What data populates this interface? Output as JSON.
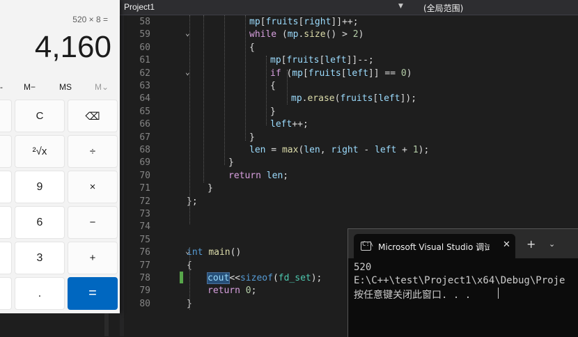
{
  "editor": {
    "project": "Project1",
    "scope": "(全局范围)",
    "lines": [
      {
        "n": "58",
        "fold": "",
        "tokens": [
          [
            "mp",
            "var"
          ],
          [
            "[",
            ""
          ],
          [
            "fruits",
            "var"
          ],
          [
            "[",
            ""
          ],
          [
            "right",
            "var"
          ],
          [
            "]]++;",
            ""
          ]
        ]
      },
      {
        "n": "59",
        "fold": "⌄",
        "tokens": [
          [
            "while",
            "kw2"
          ],
          [
            " (",
            ""
          ],
          [
            "mp",
            "var"
          ],
          [
            ".",
            ""
          ],
          [
            "size",
            "fn"
          ],
          [
            "() > ",
            ""
          ],
          [
            "2",
            "num"
          ],
          [
            ")",
            ""
          ]
        ]
      },
      {
        "n": "60",
        "fold": "",
        "tokens": [
          [
            "{",
            ""
          ]
        ]
      },
      {
        "n": "61",
        "fold": "",
        "tokens": [
          [
            "mp",
            "var"
          ],
          [
            "[",
            ""
          ],
          [
            "fruits",
            "var"
          ],
          [
            "[",
            ""
          ],
          [
            "left",
            "var"
          ],
          [
            "]]--;",
            ""
          ]
        ]
      },
      {
        "n": "62",
        "fold": "⌄",
        "tokens": [
          [
            "if",
            "kw2"
          ],
          [
            " (",
            ""
          ],
          [
            "mp",
            "var"
          ],
          [
            "[",
            ""
          ],
          [
            "fruits",
            "var"
          ],
          [
            "[",
            ""
          ],
          [
            "left",
            "var"
          ],
          [
            "]] == ",
            ""
          ],
          [
            "0",
            "num"
          ],
          [
            ")",
            ""
          ]
        ]
      },
      {
        "n": "63",
        "fold": "",
        "tokens": [
          [
            "{",
            ""
          ]
        ]
      },
      {
        "n": "64",
        "fold": "",
        "tokens": [
          [
            "mp",
            "var"
          ],
          [
            ".",
            ""
          ],
          [
            "erase",
            "fn"
          ],
          [
            "(",
            ""
          ],
          [
            "fruits",
            "var"
          ],
          [
            "[",
            ""
          ],
          [
            "left",
            "var"
          ],
          [
            "]);",
            ""
          ]
        ]
      },
      {
        "n": "65",
        "fold": "",
        "tokens": [
          [
            "}",
            ""
          ]
        ]
      },
      {
        "n": "66",
        "fold": "",
        "tokens": [
          [
            "left",
            "var"
          ],
          [
            "++;",
            ""
          ]
        ]
      },
      {
        "n": "67",
        "fold": "",
        "tokens": [
          [
            "}",
            ""
          ]
        ]
      },
      {
        "n": "68",
        "fold": "",
        "tokens": [
          [
            "len",
            "var"
          ],
          [
            " = ",
            ""
          ],
          [
            "max",
            "fn"
          ],
          [
            "(",
            ""
          ],
          [
            "len",
            "var"
          ],
          [
            ", ",
            ""
          ],
          [
            "right",
            "var"
          ],
          [
            " - ",
            ""
          ],
          [
            "left",
            "var"
          ],
          [
            " + ",
            ""
          ],
          [
            "1",
            "num"
          ],
          [
            ");",
            ""
          ]
        ]
      },
      {
        "n": "69",
        "fold": "",
        "tokens": [
          [
            "}",
            ""
          ]
        ]
      },
      {
        "n": "70",
        "fold": "",
        "tokens": [
          [
            "return",
            "kw2"
          ],
          [
            " ",
            ""
          ],
          [
            "len",
            "var"
          ],
          [
            ";",
            ""
          ]
        ]
      },
      {
        "n": "71",
        "fold": "",
        "tokens": [
          [
            "}",
            ""
          ]
        ]
      },
      {
        "n": "72",
        "fold": "",
        "tokens": [
          [
            "};",
            ""
          ]
        ]
      },
      {
        "n": "73",
        "fold": "",
        "tokens": []
      },
      {
        "n": "74",
        "fold": "",
        "tokens": []
      },
      {
        "n": "75",
        "fold": "",
        "tokens": []
      },
      {
        "n": "76",
        "fold": "⌄",
        "tokens": [
          [
            "int",
            "kw"
          ],
          [
            " ",
            ""
          ],
          [
            "main",
            "fn"
          ],
          [
            "()",
            ""
          ]
        ]
      },
      {
        "n": "77",
        "fold": "",
        "tokens": [
          [
            "{",
            ""
          ]
        ]
      },
      {
        "n": "78",
        "fold": "",
        "tokens": [
          [
            "cout",
            "var hl"
          ],
          [
            "<<",
            ""
          ],
          [
            "sizeof",
            "kw"
          ],
          [
            "(",
            ""
          ],
          [
            "fd_set",
            "ty"
          ],
          [
            ");",
            ""
          ]
        ]
      },
      {
        "n": "79",
        "fold": "",
        "tokens": [
          [
            "return",
            "kw2"
          ],
          [
            " ",
            ""
          ],
          [
            "0",
            "num"
          ],
          [
            ";",
            ""
          ]
        ]
      },
      {
        "n": "80",
        "fold": "",
        "tokens": [
          [
            "}",
            ""
          ]
        ]
      }
    ]
  },
  "console": {
    "tab_title": "Microsoft Visual Studio 调试控",
    "close_glyph": "✕",
    "new_tab_glyph": "+",
    "dropdown_glyph": "⌄",
    "output": [
      "520",
      "E:\\C++\\test\\Project1\\x64\\Debug\\Proje",
      "按任意键关闭此窗口. . ."
    ]
  },
  "calculator": {
    "expression": "520 × 8 =",
    "display": "4,160",
    "memory": [
      {
        "label": "-",
        "disabled": false
      },
      {
        "label": "M−",
        "disabled": false
      },
      {
        "label": "MS",
        "disabled": false
      },
      {
        "label": "M⌄",
        "disabled": true
      }
    ],
    "keys": [
      {
        "label": "C",
        "type": ""
      },
      {
        "label": "⌫",
        "type": ""
      },
      {
        "label": "²√x",
        "type": ""
      },
      {
        "label": "÷",
        "type": ""
      },
      {
        "label": "9",
        "type": "num"
      },
      {
        "label": "×",
        "type": ""
      },
      {
        "label": "6",
        "type": "num"
      },
      {
        "label": "−",
        "type": ""
      },
      {
        "label": "3",
        "type": "num"
      },
      {
        "label": "+",
        "type": ""
      },
      {
        "label": ".",
        "type": "num"
      },
      {
        "label": "=",
        "type": "eq"
      }
    ]
  }
}
